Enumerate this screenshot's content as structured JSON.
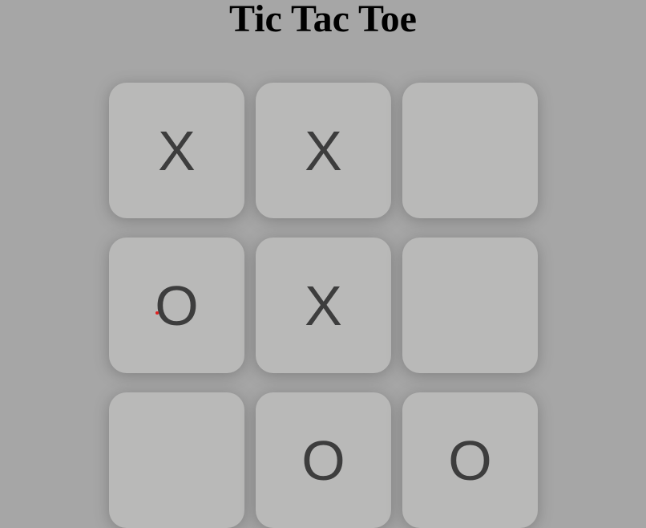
{
  "title": "Tic Tac Toe",
  "board": {
    "cells": [
      {
        "mark": "X"
      },
      {
        "mark": "X"
      },
      {
        "mark": ""
      },
      {
        "mark": "O"
      },
      {
        "mark": "X"
      },
      {
        "mark": ""
      },
      {
        "mark": ""
      },
      {
        "mark": "O"
      },
      {
        "mark": "O"
      }
    ]
  },
  "colors": {
    "background": "#a6a6a6",
    "cell": "#b9b9b8",
    "mark": "#3d3d3d",
    "cursor": "#e02020"
  }
}
